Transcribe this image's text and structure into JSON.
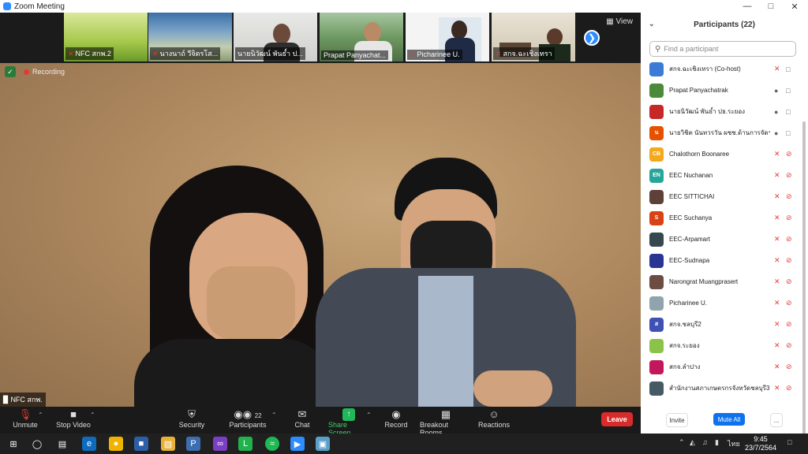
{
  "window": {
    "title": "Zoom Meeting"
  },
  "thumbnails": [
    {
      "label": "NFC สกพ.2",
      "muted": true
    },
    {
      "label": "นางนาถ์ วีจิตรโส...",
      "muted": true
    },
    {
      "label": "นายนิวัฒน์ พันธ์ำ ป...",
      "muted": false
    },
    {
      "label": "Prapat Panyachat...",
      "muted": false
    },
    {
      "label": "Picharinee U.",
      "muted": true
    },
    {
      "label": "สกจ.ฉะเชิงเทรา",
      "muted": true
    }
  ],
  "view_label": "View",
  "main_video": {
    "recording_label": "Recording",
    "speaker_name": "NFC สกพ."
  },
  "toolbar": {
    "unmute": "Unmute",
    "stop_video": "Stop Video",
    "security": "Security",
    "participants": "Participants",
    "participants_count": "22",
    "chat": "Chat",
    "share_screen": "Share Screen",
    "record": "Record",
    "breakout_rooms": "Breakout Rooms",
    "reactions": "Reactions",
    "leave": "Leave"
  },
  "panel": {
    "title": "Participants (22)",
    "search_placeholder": "Find a participant",
    "invite": "Invite",
    "mute_all": "Mute All",
    "more": "...",
    "participants": [
      {
        "name": "สกจ.ฉะเชิงเทรา (Co-host)",
        "avatar_text": "",
        "avatar_color": "#3a7bd5",
        "mic_muted": true,
        "video_off": false
      },
      {
        "name": "Prapat Panyachatrak",
        "avatar_text": "",
        "avatar_color": "#4a8a3a",
        "mic_muted": false,
        "video_off": false
      },
      {
        "name": "นายนิวัฒน์ พันธ์ำ ปธ.ระยอง",
        "avatar_text": "",
        "avatar_color": "#c62828",
        "mic_muted": false,
        "video_off": false
      },
      {
        "name": "นายวิชิต นันทวรวัน ผชช.ด้านการจัดฯ...",
        "avatar_text": "น",
        "avatar_color": "#e65100",
        "mic_muted": false,
        "video_off": false
      },
      {
        "name": "Chalothorn Boonaree",
        "avatar_text": "CB",
        "avatar_color": "#f4a81c",
        "mic_muted": true,
        "video_off": true
      },
      {
        "name": "EEC Nuchanan",
        "avatar_text": "EN",
        "avatar_color": "#26a69a",
        "mic_muted": true,
        "video_off": true
      },
      {
        "name": "EEC SITTICHAI",
        "avatar_text": "",
        "avatar_color": "#5d4037",
        "mic_muted": true,
        "video_off": true
      },
      {
        "name": "EEC Suchanya",
        "avatar_text": "S",
        "avatar_color": "#d84315",
        "mic_muted": true,
        "video_off": true
      },
      {
        "name": "EEC-Arpamart",
        "avatar_text": "",
        "avatar_color": "#37474f",
        "mic_muted": true,
        "video_off": true
      },
      {
        "name": "EEC-Sudnapa",
        "avatar_text": "",
        "avatar_color": "#283593",
        "mic_muted": true,
        "video_off": true
      },
      {
        "name": "Narongrat Muangprasert",
        "avatar_text": "",
        "avatar_color": "#6d4c41",
        "mic_muted": true,
        "video_off": true
      },
      {
        "name": "Picharinee U.",
        "avatar_text": "",
        "avatar_color": "#90a4ae",
        "mic_muted": true,
        "video_off": true
      },
      {
        "name": "สกจ.ชลบุรี2",
        "avatar_text": "ส",
        "avatar_color": "#3f51b5",
        "mic_muted": true,
        "video_off": true
      },
      {
        "name": "สกจ.ระยอง",
        "avatar_text": "",
        "avatar_color": "#8bc34a",
        "mic_muted": true,
        "video_off": true
      },
      {
        "name": "สกจ.ลำปาง",
        "avatar_text": "",
        "avatar_color": "#c2185b",
        "mic_muted": true,
        "video_off": true
      },
      {
        "name": "สำนักงานสภาเกษตรกรจังหวัดชลบุรี3",
        "avatar_text": "",
        "avatar_color": "#455a64",
        "mic_muted": true,
        "video_off": true
      }
    ]
  },
  "taskbar": {
    "language": "ไทย",
    "time": "9:45",
    "date": "23/7/2564"
  }
}
